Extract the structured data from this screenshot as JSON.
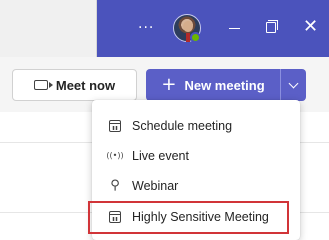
{
  "title_bar": {
    "more_glyph": "···",
    "close_glyph": "✕",
    "accent_color": "#4b53bc",
    "presence_color": "#6bb700"
  },
  "toolbar": {
    "meet_now_label": "Meet now",
    "new_meeting_label": "New meeting",
    "plus_glyph": "+",
    "accent_color": "#5b5fc7"
  },
  "dropdown": {
    "items": [
      {
        "label": "Schedule meeting",
        "icon": "calendar-icon"
      },
      {
        "label": "Live event",
        "icon": "broadcast-icon",
        "glyph": "((•))"
      },
      {
        "label": "Webinar",
        "icon": "webinar-icon",
        "glyph": "⚲"
      },
      {
        "label": "Highly Sensitive Meeting",
        "icon": "calendar-icon"
      }
    ],
    "highlight_color": "#d13438"
  }
}
